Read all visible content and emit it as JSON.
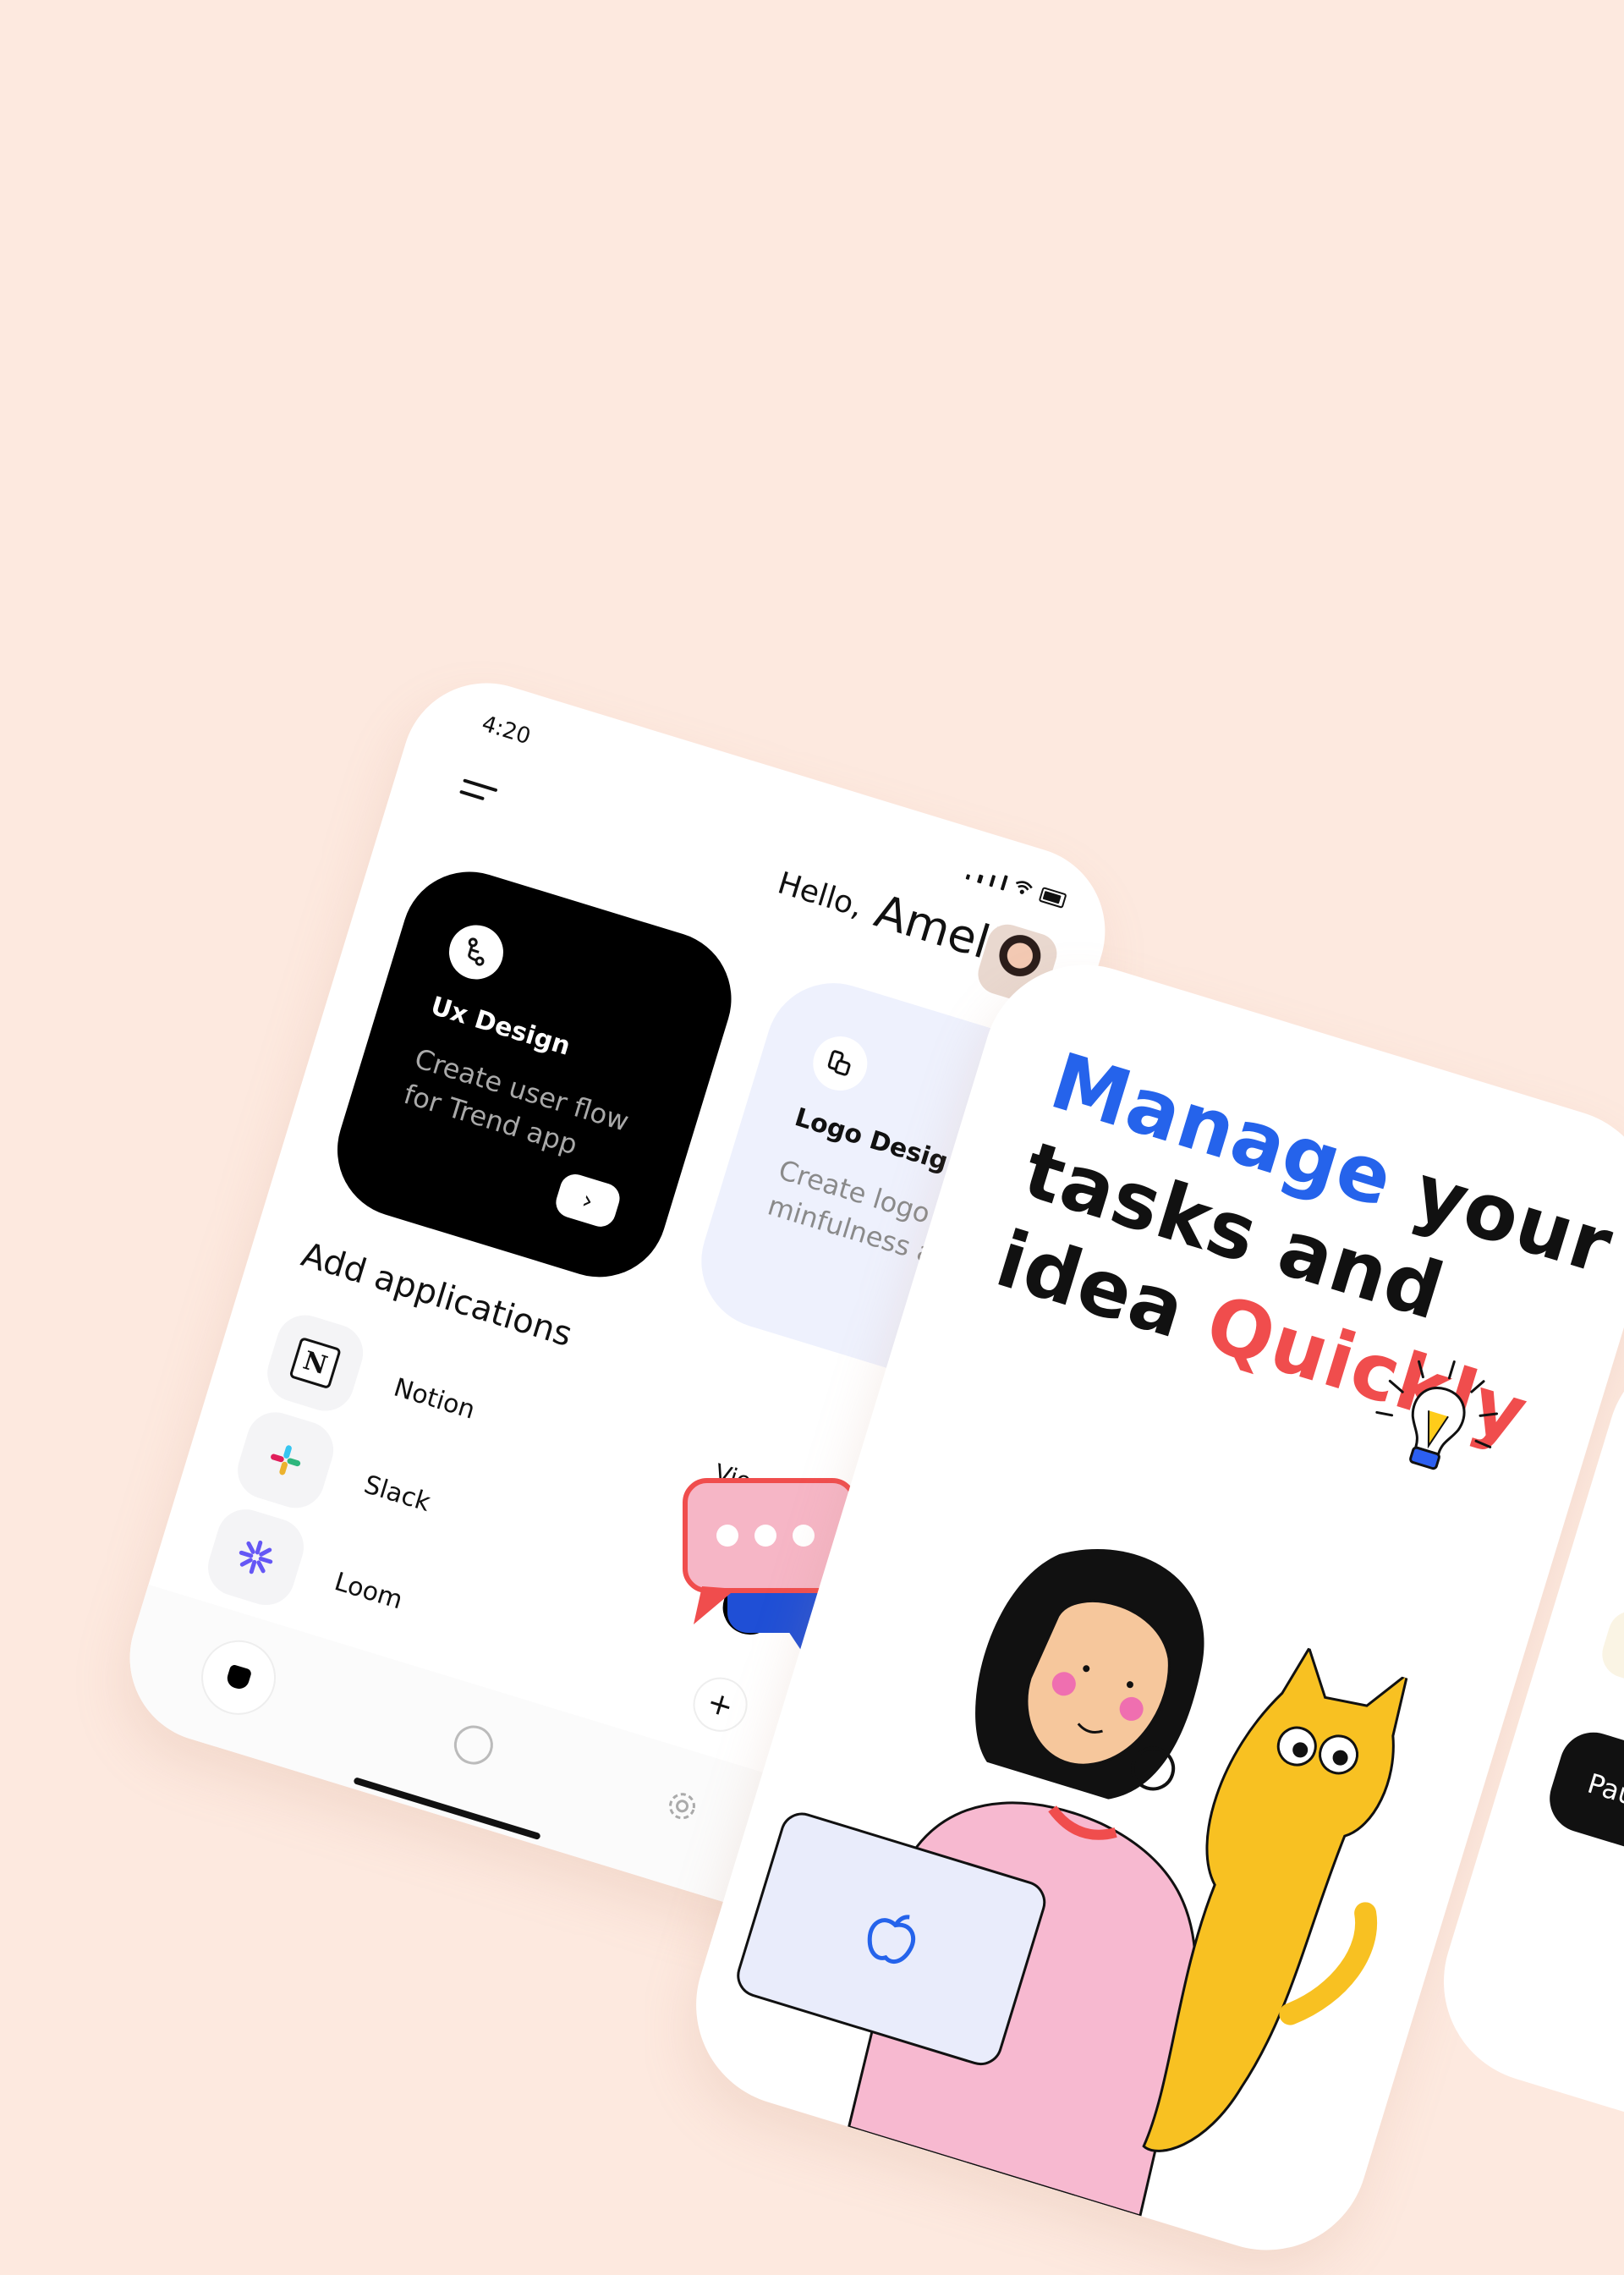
{
  "colors": {
    "background": "#fde9df",
    "accent_blue": "#2563eb",
    "accent_red": "#f04d4d",
    "card_dark": "#000000",
    "card_light": "#eef1fd"
  },
  "dashboard": {
    "status_time": "4:20",
    "greeting": "Hello,",
    "user_name": "Amelia",
    "cards": [
      {
        "title": "Ux Design",
        "subtitle": "Create user flow for Trend app",
        "icon": "flow-icon"
      },
      {
        "title": "Logo Design",
        "subtitle": "Create logo for minfulness app",
        "icon": "logo-icon"
      }
    ],
    "section_title": "Add applications",
    "view_all": "View all",
    "apps": [
      {
        "name": "Notion",
        "icon": "notion-icon"
      },
      {
        "name": "Slack",
        "icon": "slack-icon"
      },
      {
        "name": "Loom",
        "icon": "loom-icon"
      }
    ],
    "add_symbol": "+",
    "arrow_symbol": "›"
  },
  "onboarding": {
    "headline": {
      "w1": "Manage",
      "w2": "your",
      "w3": "tasks and",
      "w4": "idea",
      "w5": "Quickly"
    }
  },
  "timer_screen": {
    "pause_label": "Pause"
  }
}
